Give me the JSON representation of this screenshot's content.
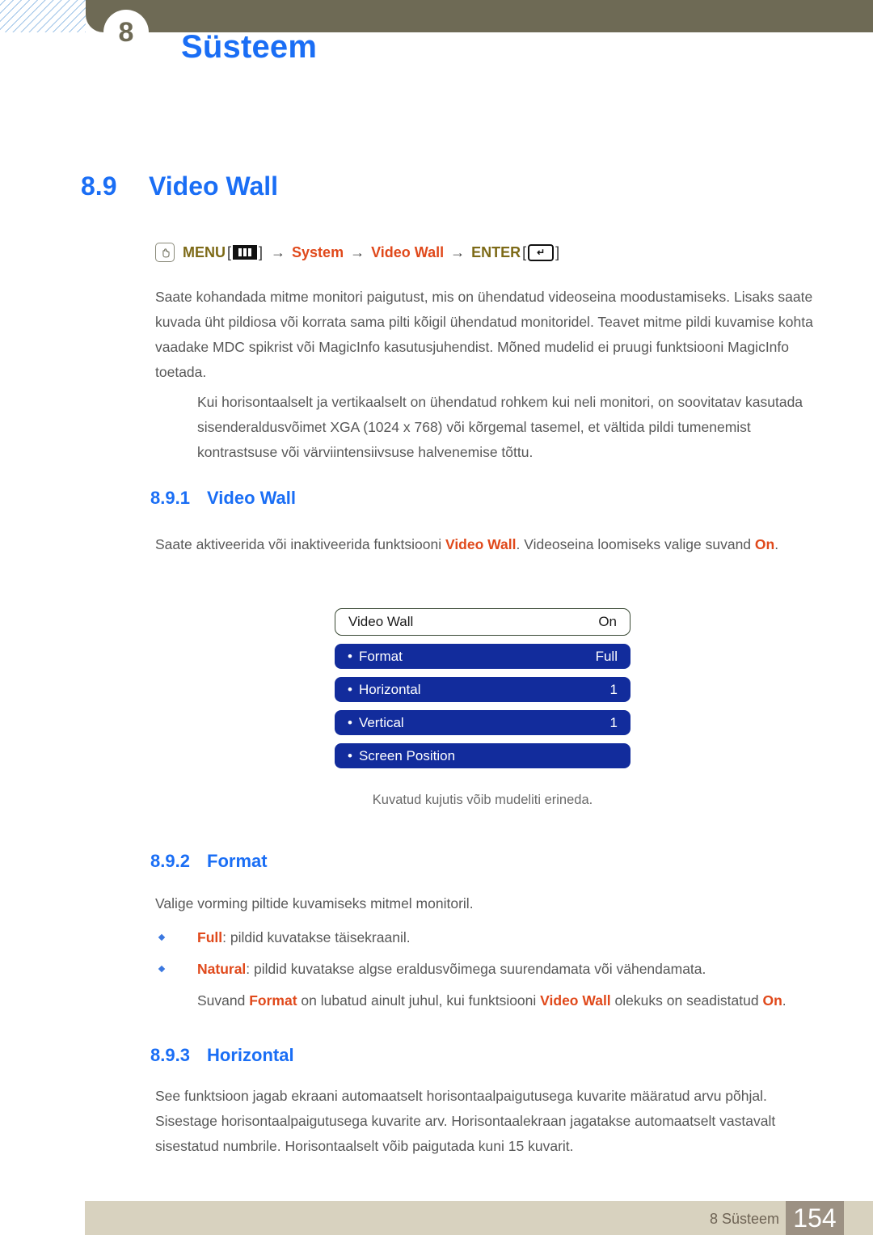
{
  "header": {
    "chapter_number": "8",
    "title": "Süsteem"
  },
  "section": {
    "number": "8.9",
    "title": "Video Wall"
  },
  "menu_path": {
    "hand_icon": "hand-press-icon",
    "menu_label": "MENU",
    "menu_icon": "menu-bars-icon",
    "arrow": "→",
    "bracket_open": "[",
    "bracket_close": "]",
    "item_system": "System",
    "item_video_wall": "Video Wall",
    "enter_label": "ENTER",
    "enter_icon": "enter-return-icon",
    "enter_glyph": "↵"
  },
  "intro_paragraph": "Saate kohandada mitme monitori paigutust, mis on ühendatud videoseina moodustamiseks. Lisaks saate kuvada üht pildiosa või korrata sama pilti kõigil ühendatud monitoridel. Teavet mitme pildi kuvamise kohta vaadake MDC spikrist või MagicInfo kasutusjuhendist. Mõned mudelid ei pruugi funktsiooni MagicInfo toetada.",
  "note_paragraph": "Kui horisontaalselt ja vertikaalselt on ühendatud rohkem kui neli monitori, on soovitatav kasutada sisenderaldusvõimet XGA (1024 x 768) või kõrgemal tasemel, et vältida pildi tumenemist kontrastsuse või värviintensiivsuse halvenemise tõttu.",
  "sub_8_9_1": {
    "number": "8.9.1",
    "title": "Video Wall",
    "body_part1": "Saate aktiveerida või inaktiveerida funktsiooni ",
    "body_hl1": "Video Wall",
    "body_part2": ". Videoseina loomiseks valige suvand ",
    "body_hl2": "On",
    "body_part3": "."
  },
  "osd": {
    "title_label": "Video Wall",
    "title_value": "On",
    "items": [
      {
        "label": "Format",
        "value": "Full"
      },
      {
        "label": "Horizontal",
        "value": "1"
      },
      {
        "label": "Vertical",
        "value": "1"
      },
      {
        "label": "Screen Position",
        "value": ""
      }
    ],
    "caption": "Kuvatud kujutis võib mudeliti erineda."
  },
  "sub_8_9_2": {
    "number": "8.9.2",
    "title": "Format",
    "body": "Valige vorming piltide kuvamiseks mitmel monitoril.",
    "bullets": [
      {
        "term": "Full",
        "text": ": pildid kuvatakse täisekraanil."
      },
      {
        "term": "Natural",
        "text": ": pildid kuvatakse algse eraldusvõimega suurendamata või vähendamata."
      }
    ],
    "note_part1": "Suvand ",
    "note_hl1": "Format",
    "note_part2": " on lubatud ainult juhul, kui funktsiooni ",
    "note_hl2": "Video Wall",
    "note_part3": " olekuks on seadistatud ",
    "note_hl3": "On",
    "note_part4": "."
  },
  "sub_8_9_3": {
    "number": "8.9.3",
    "title": "Horizontal",
    "body": "See funktsioon jagab ekraani automaatselt horisontaalpaigutusega kuvarite määratud arvu põhjal. Sisestage horisontaalpaigutusega kuvarite arv. Horisontaalekraan jagatakse automaatselt vastavalt sisestatud numbrile. Horisontaalselt võib paigutada kuni 15 kuvarit."
  },
  "footer": {
    "label": "8 Süsteem",
    "page": "154"
  },
  "colors": {
    "heading_blue": "#1a6ef5",
    "accent_orange": "#e0491b",
    "menu_key_olive": "#7d6a17",
    "header_olive": "#6e6a55",
    "osd_blue": "#122c9c",
    "footer_beige": "#d8d2bf",
    "footer_page_taupe": "#9c9183"
  }
}
